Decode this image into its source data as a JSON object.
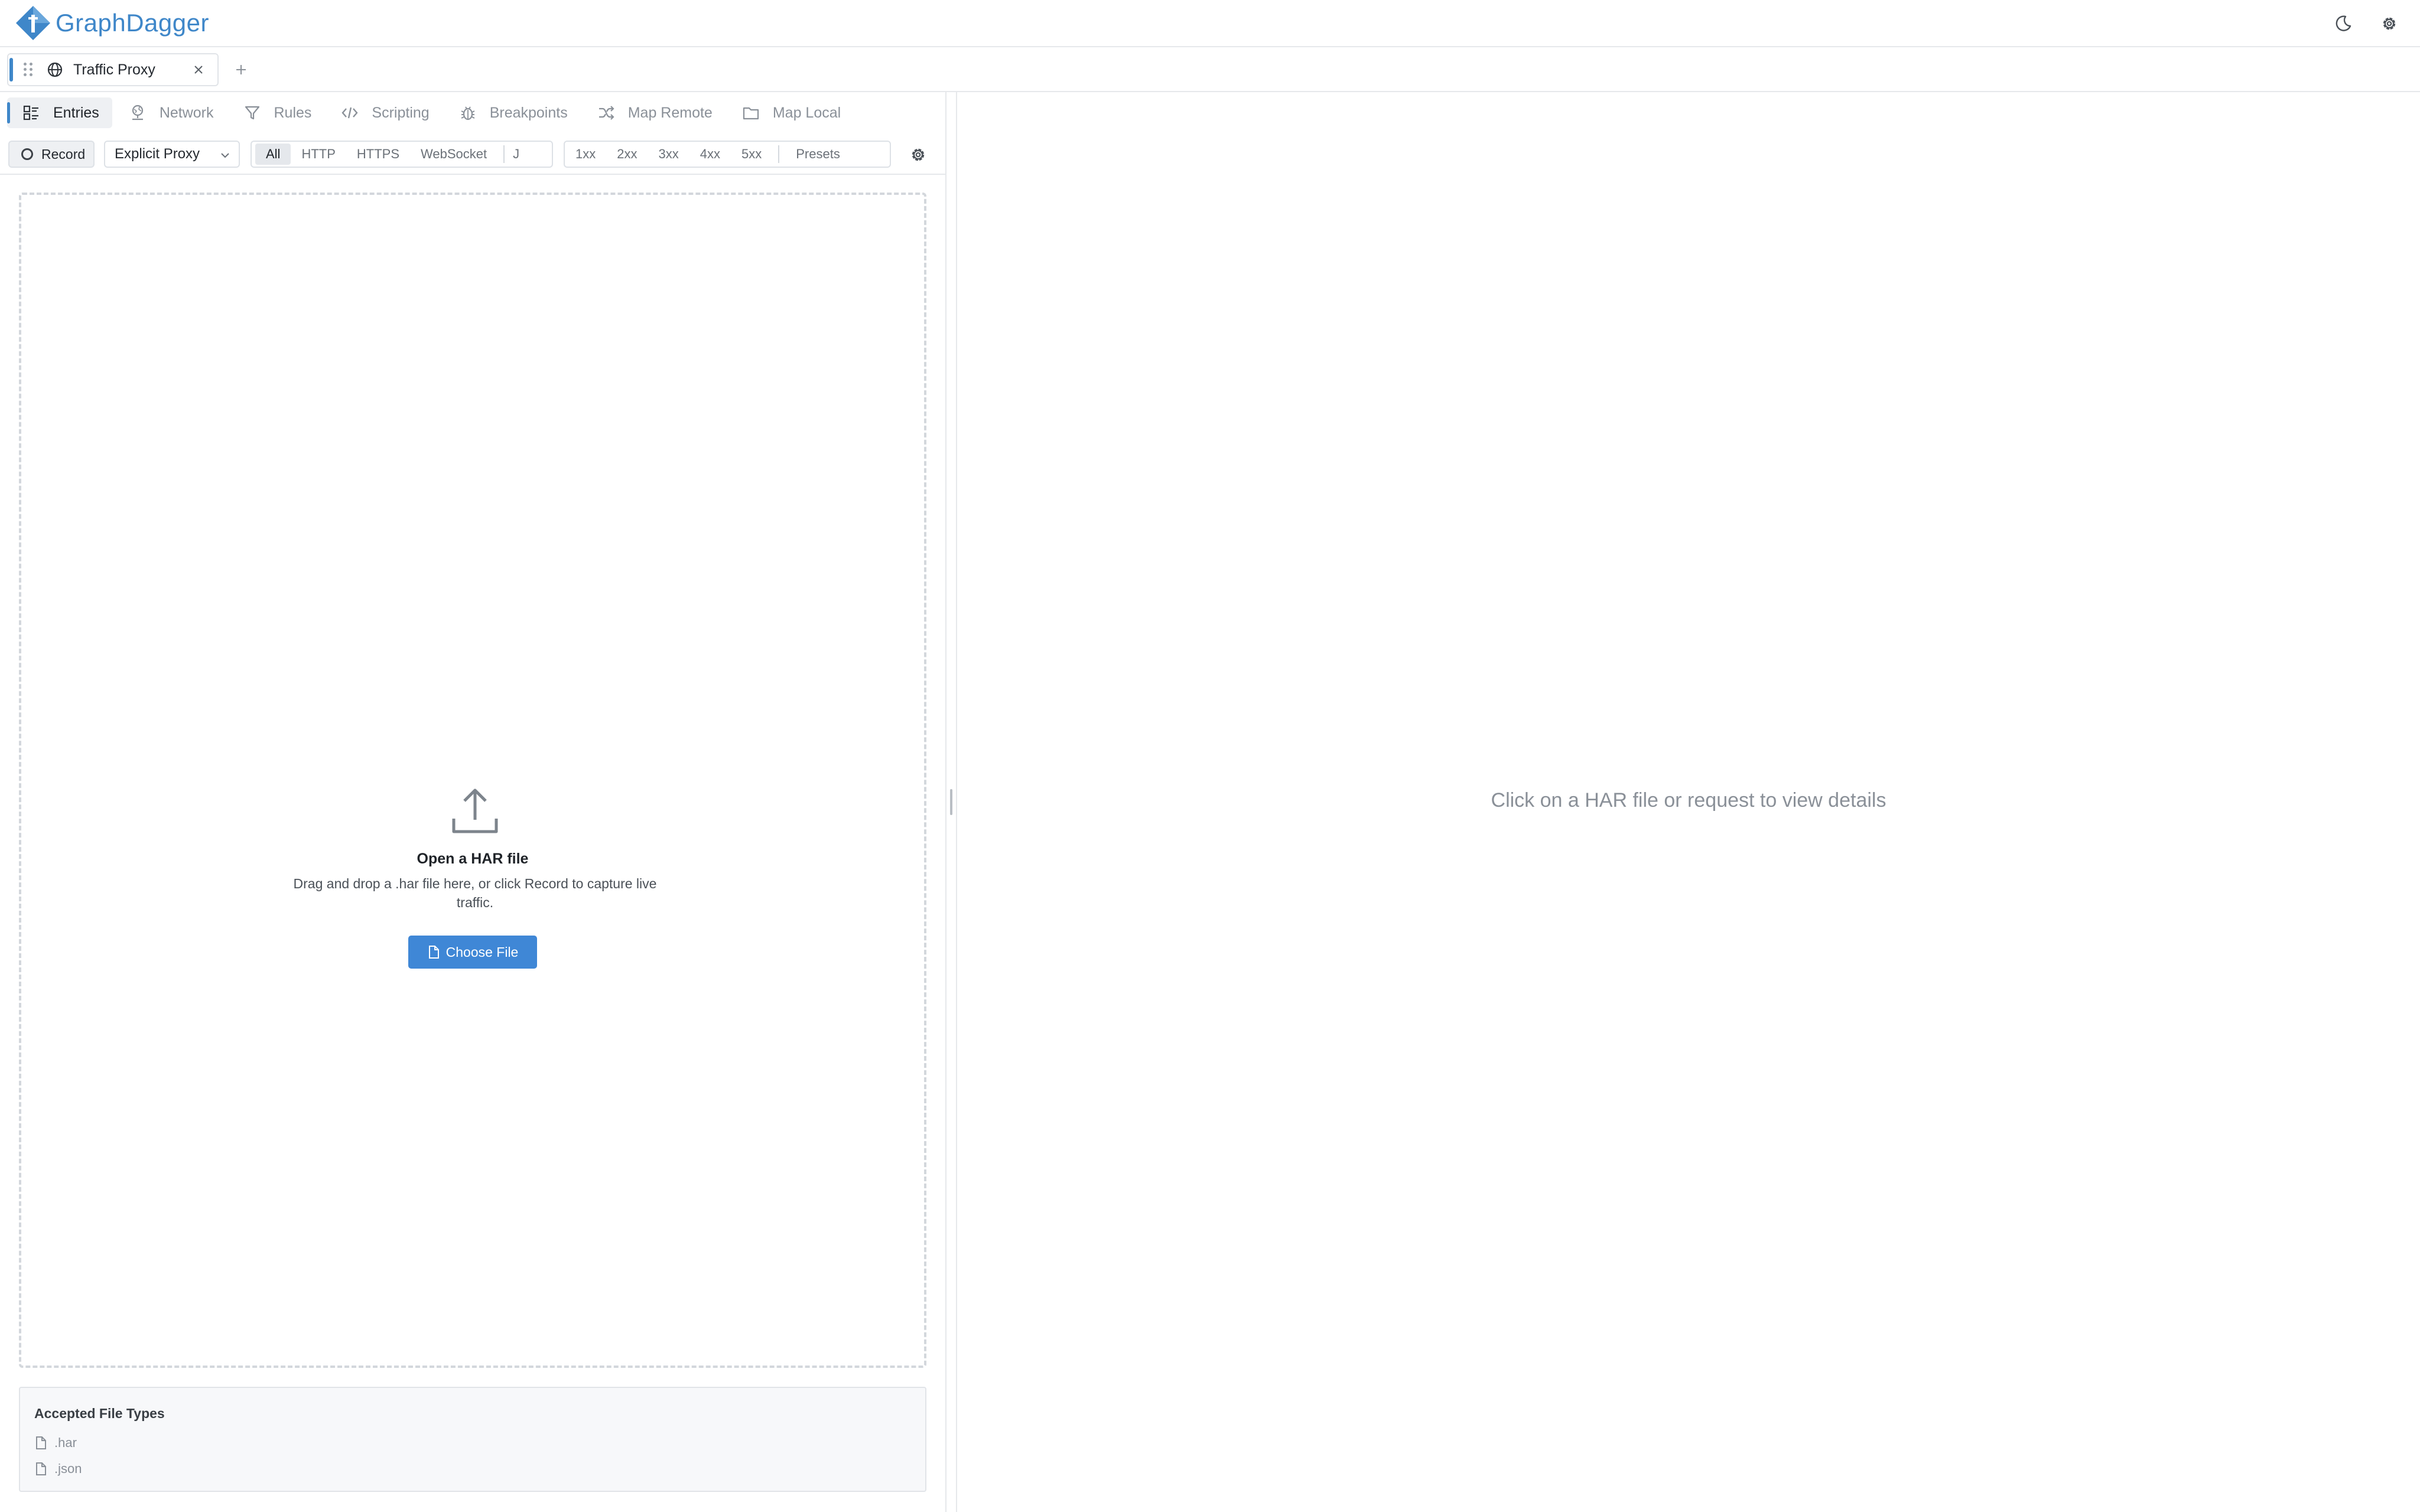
{
  "app": {
    "name": "GraphDagger"
  },
  "header": {
    "theme_toggle_icon": "moon-icon",
    "settings_icon": "gear-icon"
  },
  "tabs": [
    {
      "label": "Traffic Proxy",
      "icon": "globe-icon",
      "active": true
    }
  ],
  "subnav": {
    "items": [
      {
        "label": "Entries",
        "icon": "entries-icon",
        "active": true
      },
      {
        "label": "Network",
        "icon": "network-icon",
        "active": false
      },
      {
        "label": "Rules",
        "icon": "filter-icon",
        "active": false
      },
      {
        "label": "Scripting",
        "icon": "code-icon",
        "active": false
      },
      {
        "label": "Breakpoints",
        "icon": "bug-icon",
        "active": false
      },
      {
        "label": "Map Remote",
        "icon": "shuffle-icon",
        "active": false
      },
      {
        "label": "Map Local",
        "icon": "folder-icon",
        "active": false
      }
    ]
  },
  "toolbar": {
    "record_label": "Record",
    "proxy_mode": "Explicit Proxy",
    "protocol_filters": [
      "All",
      "HTTP",
      "HTTPS",
      "WebSocket",
      "J"
    ],
    "status_filters": [
      "1xx",
      "2xx",
      "3xx",
      "4xx",
      "5xx"
    ],
    "presets_label": "Presets"
  },
  "drop_zone": {
    "title": "Open a HAR file",
    "description": "Drag and drop a .har file here, or click Record to capture live traffic.",
    "button_label": "Choose File"
  },
  "accepted": {
    "title": "Accepted File Types",
    "types": [
      ".har",
      ".json"
    ]
  },
  "details": {
    "empty_message": "Click on a HAR file or request to view details"
  },
  "colors": {
    "accent": "#3f87c9",
    "primary_button": "#3f87d6"
  }
}
